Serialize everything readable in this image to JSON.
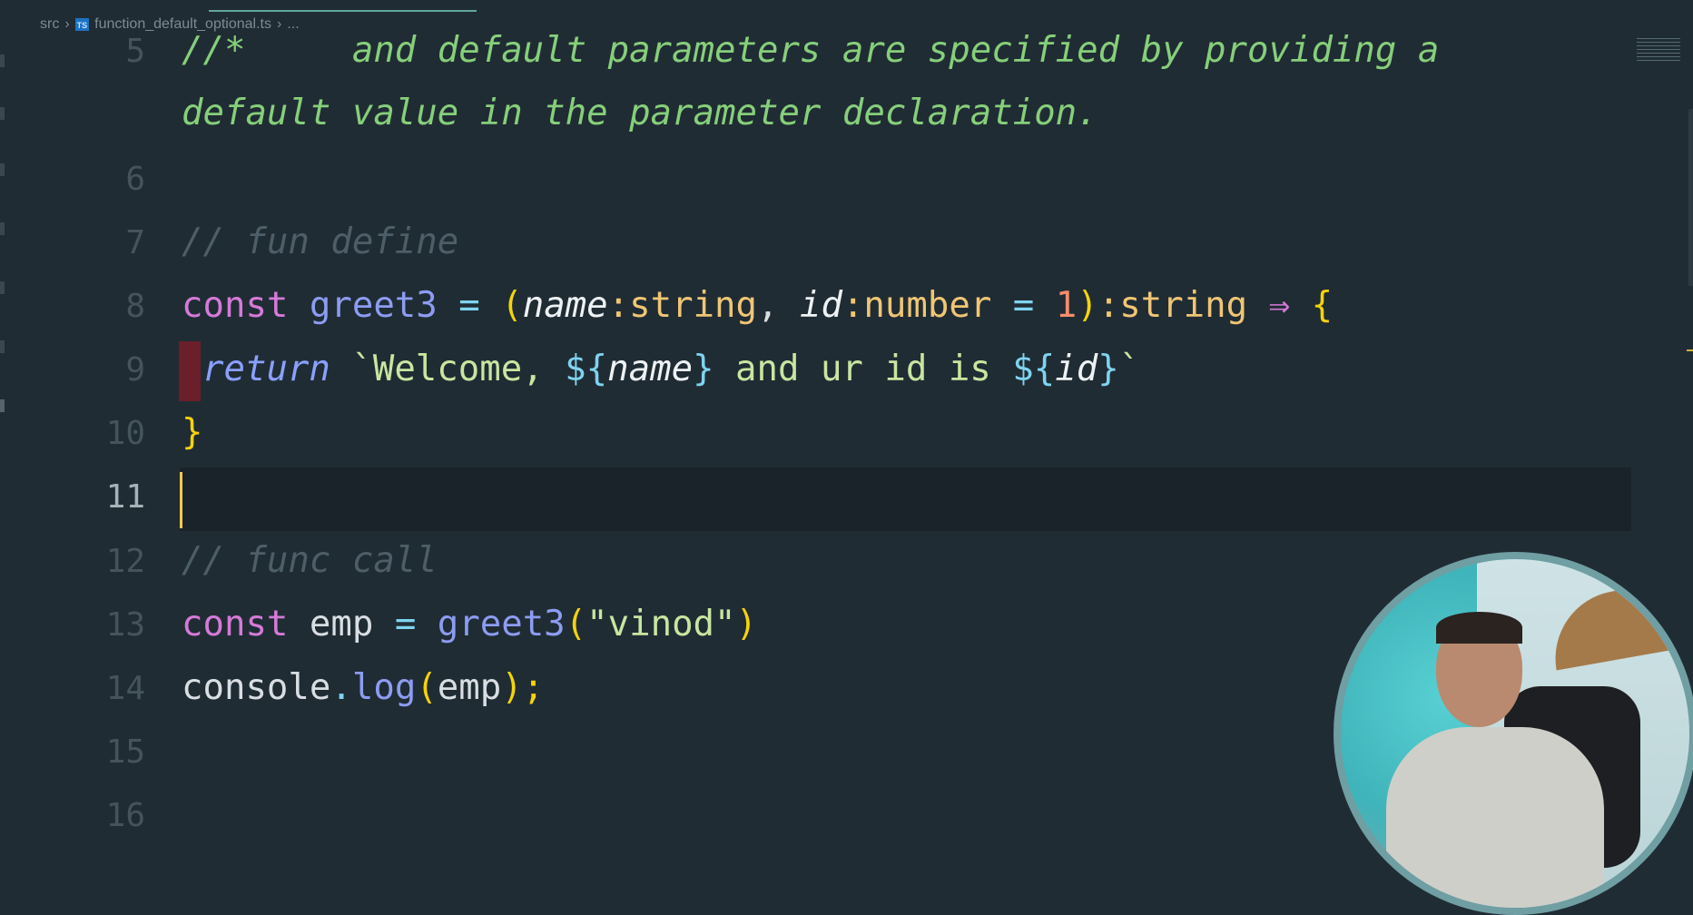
{
  "breadcrumb": {
    "folder": "src",
    "file_badge": "TS",
    "file": "function_default_optional.ts",
    "more": "..."
  },
  "colors": {
    "background": "#202c34",
    "comment": "#86cf7a",
    "keyword": "#d57ad8",
    "cursor": "#f2c94c"
  },
  "editor": {
    "line_numbers": [
      "5",
      "6",
      "7",
      "8",
      "9",
      "10",
      "11",
      "12",
      "13",
      "14",
      "15",
      "16"
    ],
    "current_line": "11",
    "lines": {
      "l5a": "//*     and default parameters are specified by providing a",
      "l5b": "default value in the parameter declaration.",
      "l7": "// fun define",
      "l8": [
        "const",
        " ",
        "greet3",
        " = ",
        "(",
        "name",
        ":string",
        ", ",
        "id",
        ":number",
        " = ",
        "1",
        ")",
        ":string",
        " ⇒ ",
        "{"
      ],
      "l9": [
        "return",
        " `Welcome, ",
        "${",
        "name",
        "}",
        " and ur id is ",
        "${",
        "id",
        "}",
        "`"
      ],
      "l10": "}",
      "l12": "// func call",
      "l13": [
        "const",
        " emp ",
        "=",
        " ",
        "greet3",
        "(",
        "\"vinod\"",
        ")"
      ],
      "l14": [
        "console",
        ".",
        "log",
        "(",
        "emp",
        ");"
      ]
    }
  },
  "webcam": {
    "icon": "presenter-webcam"
  }
}
